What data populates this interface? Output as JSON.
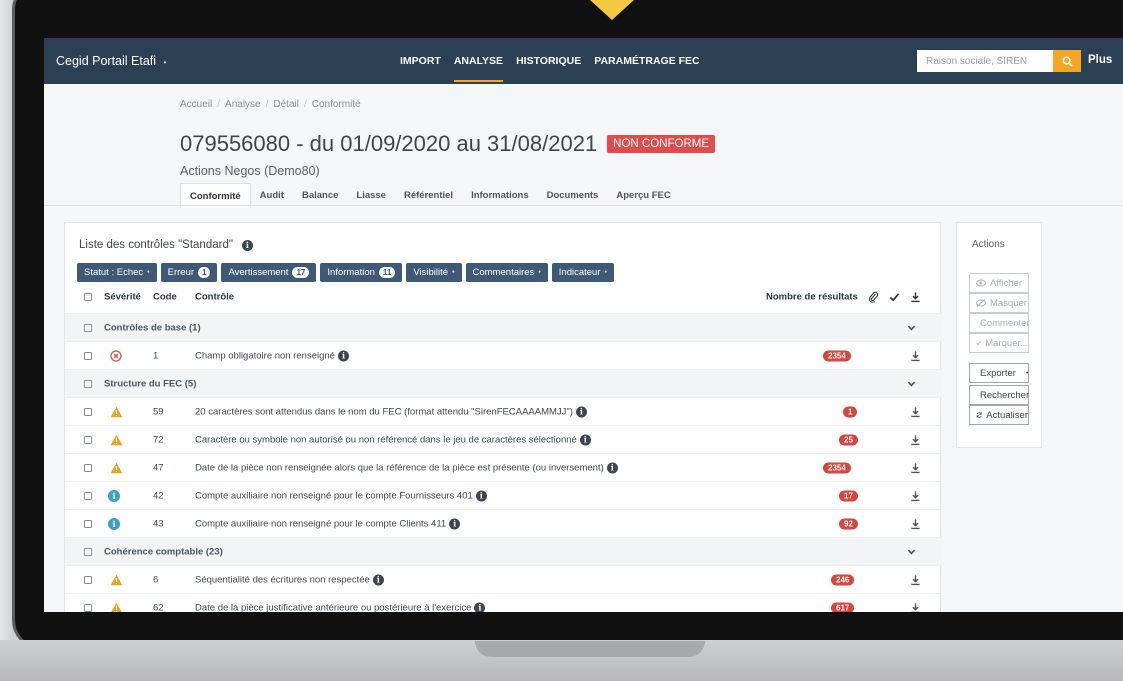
{
  "app": {
    "brand": "Cegid Portail Etafi",
    "brand_caret": "▾"
  },
  "nav": [
    "IMPORT",
    "ANALYSE",
    "HISTORIQUE",
    "PARAMÉTRAGE FEC"
  ],
  "search": {
    "placeholder": "Raison sociale, SIREN"
  },
  "plus": "Plus",
  "breadcrumb": [
    "Accueil",
    "Analyse",
    "Détail",
    "Conformité"
  ],
  "title": "079556080 - du 01/09/2020 au 31/08/2021",
  "status_badge": "NON CONFORME",
  "subtitle": "Actions Negos (Demo80)",
  "tabs": [
    "Conformité",
    "Audit",
    "Balance",
    "Liasse",
    "Référentiel",
    "Informations",
    "Documents",
    "Aperçu FEC"
  ],
  "card_title": "Liste des contrôles \"Standard\"",
  "filters": {
    "statut": "Statut : Echec",
    "erreur": "Erreur",
    "erreur_count": "1",
    "avertissement": "Avertissement",
    "avertissement_count": "17",
    "information": "Information",
    "information_count": "11",
    "visibilite": "Visibilité",
    "commentaires": "Commentaires",
    "indicateur": "Indicateur"
  },
  "columns": {
    "severite": "Sévérité",
    "code": "Code",
    "controle": "Contrôle",
    "resultats": "Nombre de résultats"
  },
  "groups": {
    "base": "Contrôles de base (1)",
    "structure": "Structure du FEC (5)",
    "coherence": "Cohérence comptable (23)"
  },
  "rows": {
    "r1": {
      "code": "1",
      "label": "Champ obligatoire non renseigné",
      "count": "2354",
      "severity": "error"
    },
    "r59": {
      "code": "59",
      "label": "20 caractères sont attendus dans le nom du FEC (format attendu \"SirenFECAAAAMMJJ\")",
      "count": "1",
      "severity": "warning"
    },
    "r72": {
      "code": "72",
      "label": "Caractère ou symbole non autorisé ou non référencé dans le jeu de caractères sélectionné",
      "count": "25",
      "severity": "warning"
    },
    "r47": {
      "code": "47",
      "label": "Date de la pièce non renseignée alors que la référence de la pièce est présente (ou inversement)",
      "count": "2354",
      "severity": "warning"
    },
    "r42": {
      "code": "42",
      "label": "Compte auxiliaire non renseigné pour le compte Fournisseurs 401",
      "count": "17",
      "severity": "info"
    },
    "r43": {
      "code": "43",
      "label": "Compte auxiliaire non renseigné pour le compte Clients 411",
      "count": "92",
      "severity": "info"
    },
    "r6": {
      "code": "6",
      "label": "Séquentialité des écritures non respectée",
      "count": "246",
      "severity": "warning"
    },
    "r62": {
      "code": "62",
      "label": "Date de la pièce justificative antérieure ou postérieure à l'exercice",
      "count": "617",
      "severity": "warning"
    }
  },
  "actions": {
    "title": "Actions",
    "afficher": "Afficher",
    "masquer": "Masquer",
    "commenter": "Commenter",
    "marquer": "Marquer...",
    "exporter": "Exporter",
    "rechercher": "Rechercher",
    "actualiser": "Actualiser"
  },
  "colors": {
    "navbar": "#2b3f55",
    "accent": "#f5a623",
    "danger": "#e04b4b",
    "filter": "#3e5a76",
    "warning": "#f0a020",
    "info": "#3aa0c8"
  }
}
